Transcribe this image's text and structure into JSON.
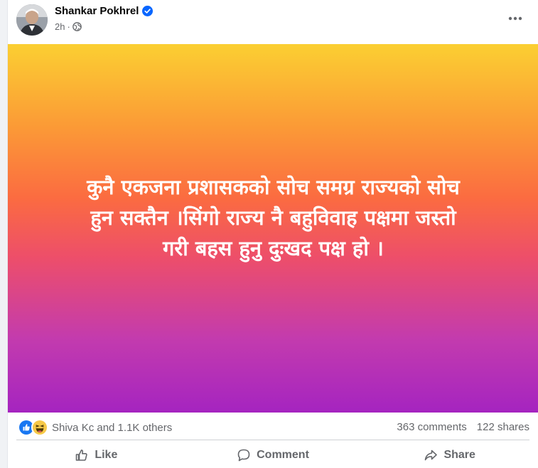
{
  "post": {
    "author": "Shankar Pokhrel",
    "time": "2h",
    "separator": "·",
    "text_lines": [
      "कुनै एकजना प्रशासकको सोच समग्र राज्यको सोच",
      "हुन सक्तैन ।सिंगो राज्य नै बहुविवाह पक्षमा जस्तो",
      "गरी बहस हुनु दुःखद पक्ष हो ।"
    ],
    "banner_colors": [
      "#fbcf32",
      "#fb6b41",
      "#a524c0"
    ]
  },
  "stats": {
    "reactors": "Shiva Kc and 1.1K others",
    "comments": "363 comments",
    "shares": "122 shares"
  },
  "actions": {
    "like": "Like",
    "comment": "Comment",
    "share": "Share"
  },
  "icons": {
    "verified": "verified-badge-icon",
    "audience": "globe-icon",
    "more": "more-options-icon",
    "reaction_1": "like-reaction-icon",
    "reaction_2": "haha-reaction-icon"
  },
  "colors": {
    "accent": "#0866ff",
    "secondary_text": "#65676b"
  }
}
